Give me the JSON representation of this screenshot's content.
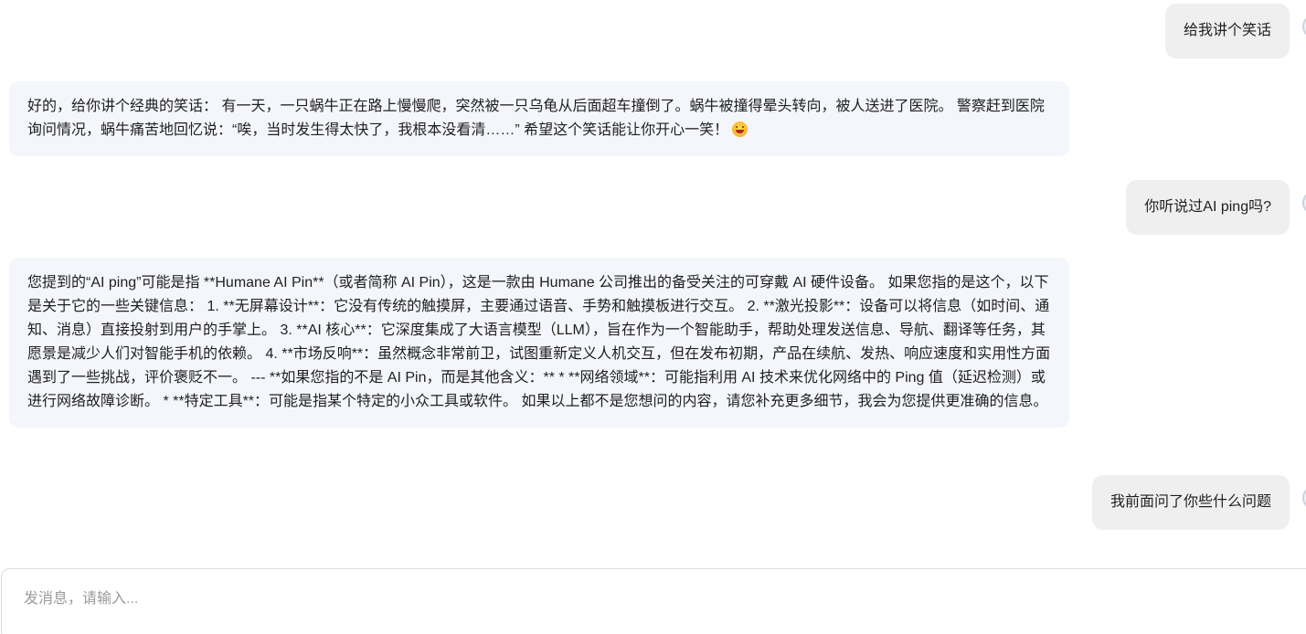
{
  "conversation": {
    "messages": [
      {
        "role": "user",
        "text": "给我讲个笑话"
      },
      {
        "role": "assistant",
        "text": "好的，给你讲个经典的笑话： 有一天，一只蜗牛正在路上慢慢爬，突然被一只乌龟从后面超车撞倒了。蜗牛被撞得晕头转向，被人送进了医院。 警察赶到医院询问情况，蜗牛痛苦地回忆说：“唉，当时发生得太快了，我根本没看清……” 希望这个笑话能让你开心一笑！",
        "emoji": "grinning-face-emoji"
      },
      {
        "role": "user",
        "text": "你听说过AI ping吗?"
      },
      {
        "role": "assistant",
        "text": "您提到的“AI ping”可能是指 **Humane AI Pin**（或者简称 AI Pin），这是一款由 Humane 公司推出的备受关注的可穿戴 AI 硬件设备。 如果您指的是这个，以下是关于它的一些关键信息： 1. **无屏幕设计**：它没有传统的触摸屏，主要通过语音、手势和触摸板进行交互。 2. **激光投影**：设备可以将信息（如时间、通知、消息）直接投射到用户的手掌上。 3. **AI 核心**：它深度集成了大语言模型（LLM），旨在作为一个智能助手，帮助处理发送信息、导航、翻译等任务，其愿景是减少人们对智能手机的依赖。 4. **市场反响**：虽然概念非常前卫，试图重新定义人机交互，但在发布初期，产品在续航、发热、响应速度和实用性方面遇到了一些挑战，评价褒贬不一。 --- **如果您指的不是 AI Pin，而是其他含义：** * **网络领域**：可能指利用 AI 技术来优化网络中的 Ping 值（延迟检测）或进行网络故障诊断。 * **特定工具**：可能是指某个特定的小众工具或软件。 如果以上都不是您想问的内容，请您补充更多细节，我会为您提供更准确的信息。"
      },
      {
        "role": "user",
        "text": "我前面问了你些什么问题"
      }
    ]
  },
  "composer": {
    "placeholder": "发消息，请输入...",
    "value": ""
  },
  "colors": {
    "user_bubble": "#efefef",
    "assistant_bubble": "#f4f6fb",
    "placeholder": "#9a9a9a"
  }
}
